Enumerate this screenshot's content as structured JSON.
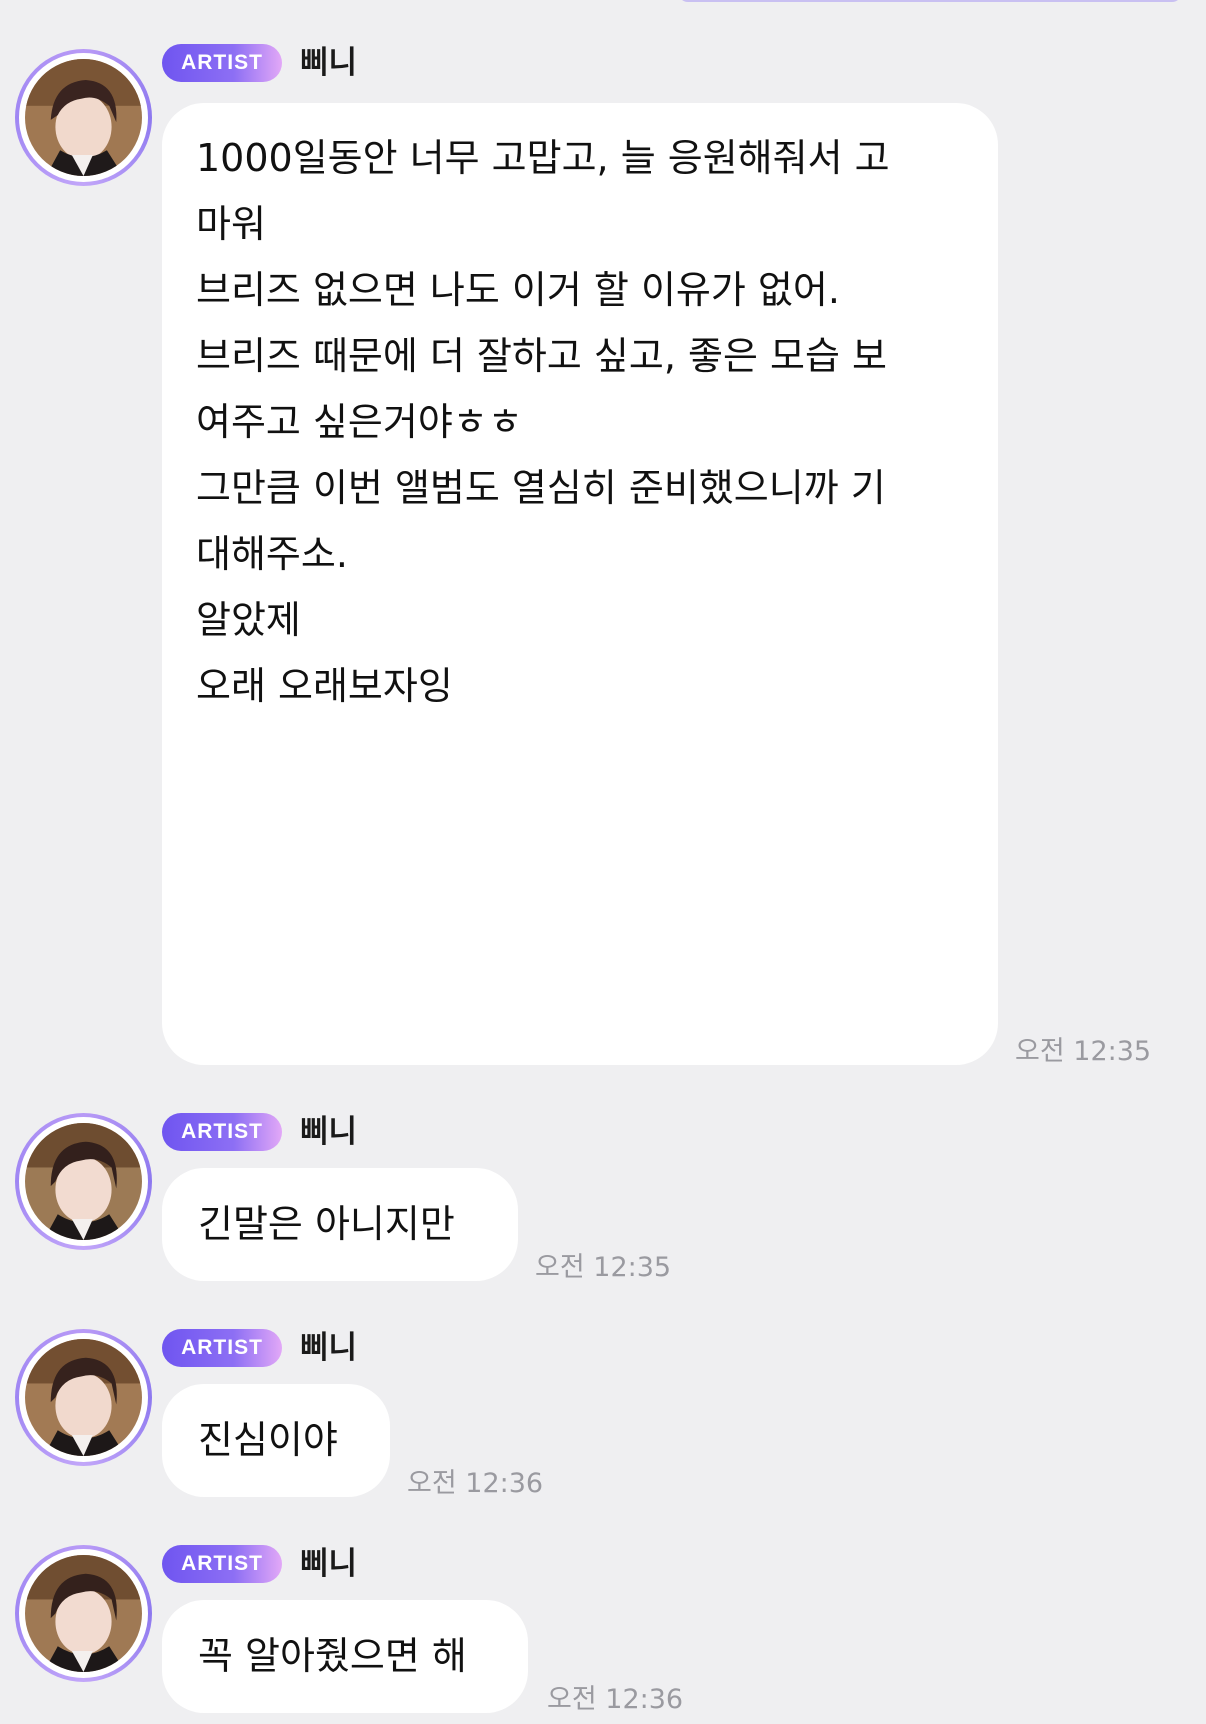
{
  "colors": {
    "background": "#efeff1",
    "bubble": "#ffffff",
    "badge_gradient_start": "#6f55f0",
    "badge_gradient_end": "#e2a8f7",
    "timestamp": "#9a9aa0",
    "avatar_ring": "#9f86f3"
  },
  "messages": [
    {
      "badge": "ARTIST",
      "sender": "삐니",
      "lines": [
        "1000일동안 너무 고맙고, 늘 응원해줘서 고",
        "마워",
        "브리즈 없으면 나도 이거 할 이유가 없어.",
        "브리즈 때문에 더 잘하고 싶고, 좋은 모습 보",
        "여주고 싶은거야ㅎㅎ",
        "그만큼 이번 앨범도 열심히 준비했으니까 기",
        "대해주소.",
        "알았제",
        "오래 오래보자잉"
      ],
      "time": "오전 12:35"
    },
    {
      "badge": "ARTIST",
      "sender": "삐니",
      "lines": [
        "긴말은 아니지만"
      ],
      "time": "오전 12:35"
    },
    {
      "badge": "ARTIST",
      "sender": "삐니",
      "lines": [
        "진심이야"
      ],
      "time": "오전 12:36"
    },
    {
      "badge": "ARTIST",
      "sender": "삐니",
      "lines": [
        "꼭 알아줬으면 해"
      ],
      "time": "오전 12:36"
    }
  ]
}
